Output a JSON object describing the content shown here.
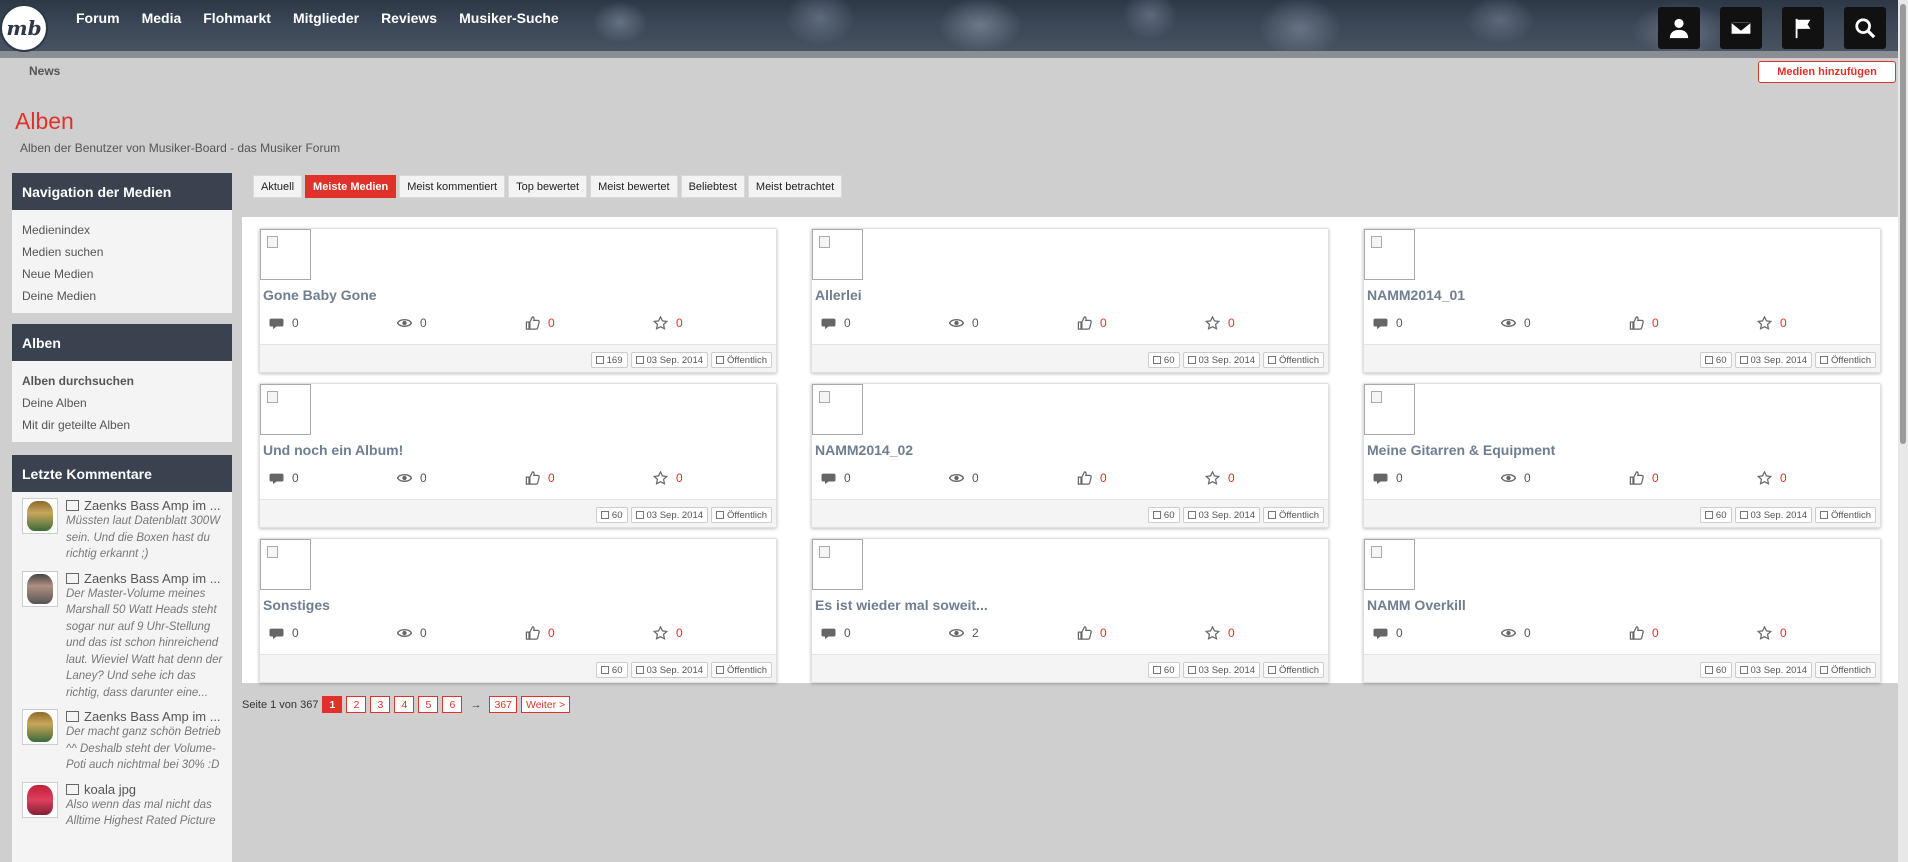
{
  "header": {
    "logo_text": "mb",
    "nav": [
      "Forum",
      "Media",
      "Flohmarkt",
      "Mitglieder",
      "Reviews",
      "Musiker-Suche"
    ],
    "icons": [
      "user-icon",
      "mail-icon",
      "flag-icon",
      "search-icon"
    ]
  },
  "breadcrumb": "News",
  "add_media_label": "Medien hinzufügen",
  "page": {
    "title": "Alben",
    "description": "Alben der Benutzer von Musiker-Board - das Musiker Forum"
  },
  "sidebar": {
    "nav_title": "Navigation der Medien",
    "nav_links": [
      "Medienindex",
      "Medien suchen",
      "Neue Medien",
      "Deine Medien"
    ],
    "albums_title": "Alben",
    "album_links": [
      "Alben durchsuchen",
      "Deine Alben",
      "Mit dir geteilte Alben"
    ],
    "comments_title": "Letzte Kommentare",
    "comments": [
      {
        "title": "Zaenks Bass Amp im ...",
        "text": "Müssten laut Datenblatt 300W sein. Und die Boxen hast du richtig erkannt ;)"
      },
      {
        "title": "Zaenks Bass Amp im ...",
        "text": "Der Master-Volume meines Marshall 50 Watt Heads steht sogar nur auf 9 Uhr-Stellung und das ist schon hinreichend laut. Wieviel Watt hat denn der Laney? Und sehe ich das richtig, dass darunter eine..."
      },
      {
        "title": "Zaenks Bass Amp im ...",
        "text": "Der macht ganz schön Betrieb ^^ Deshalb steht der Volume-Poti auch nichtmal bei 30% :D"
      },
      {
        "title": "koala jpg",
        "text": "Also wenn das mal nicht das Alltime Highest Rated Picture"
      }
    ]
  },
  "tabs": [
    "Aktuell",
    "Meiste Medien",
    "Meist kommentiert",
    "Top bewertet",
    "Meist bewertet",
    "Beliebtest",
    "Meist betrachtet"
  ],
  "active_tab": "Meiste Medien",
  "albums": [
    {
      "title": "Gone Baby Gone",
      "comments": "0",
      "views": "0",
      "likes": "0",
      "ratings": "0",
      "count": "169",
      "date": "03 Sep. 2014",
      "visibility": "Öffentlich"
    },
    {
      "title": "Allerlei",
      "comments": "0",
      "views": "0",
      "likes": "0",
      "ratings": "0",
      "count": "60",
      "date": "03 Sep. 2014",
      "visibility": "Öffentlich"
    },
    {
      "title": "NAMM2014_01",
      "comments": "0",
      "views": "0",
      "likes": "0",
      "ratings": "0",
      "count": "60",
      "date": "03 Sep. 2014",
      "visibility": "Öffentlich"
    },
    {
      "title": "Und noch ein Album!",
      "comments": "0",
      "views": "0",
      "likes": "0",
      "ratings": "0",
      "count": "60",
      "date": "03 Sep. 2014",
      "visibility": "Öffentlich"
    },
    {
      "title": "NAMM2014_02",
      "comments": "0",
      "views": "0",
      "likes": "0",
      "ratings": "0",
      "count": "60",
      "date": "03 Sep. 2014",
      "visibility": "Öffentlich"
    },
    {
      "title": "Meine Gitarren & Equipment",
      "comments": "0",
      "views": "0",
      "likes": "0",
      "ratings": "0",
      "count": "60",
      "date": "03 Sep. 2014",
      "visibility": "Öffentlich"
    },
    {
      "title": "Sonstiges",
      "comments": "0",
      "views": "0",
      "likes": "0",
      "ratings": "0",
      "count": "60",
      "date": "03 Sep. 2014",
      "visibility": "Öffentlich"
    },
    {
      "title": "Es ist wieder mal soweit...",
      "comments": "0",
      "views": "2",
      "likes": "0",
      "ratings": "0",
      "count": "60",
      "date": "03 Sep. 2014",
      "visibility": "Öffentlich"
    },
    {
      "title": "NAMM Overkill",
      "comments": "0",
      "views": "0",
      "likes": "0",
      "ratings": "0",
      "count": "60",
      "date": "03 Sep. 2014",
      "visibility": "Öffentlich"
    }
  ],
  "pagination": {
    "label": "Seite 1 von 367",
    "pages": [
      "1",
      "2",
      "3",
      "4",
      "5",
      "6"
    ],
    "current": "1",
    "arrow": "→",
    "last": "367",
    "next": "Weiter >"
  },
  "colors": {
    "accent": "#e0322a",
    "header": "#2d3846",
    "sidebar_head": "#3a4250"
  }
}
